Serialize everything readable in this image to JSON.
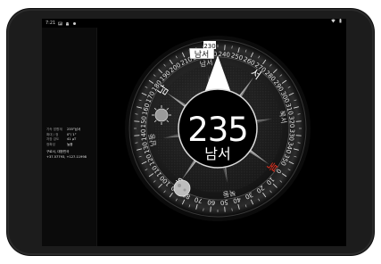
{
  "status_bar": {
    "time": "7:21",
    "left_icons": [
      "image-icon",
      "android-icon",
      "notification-icon"
    ],
    "right_icons": [
      "wifi-icon",
      "battery-icon"
    ]
  },
  "side_panel": {
    "rows": [
      {
        "key": "기속 방향계",
        "value": "235°남서"
      },
      {
        "key": "확대 / 정",
        "value": "0°/ 1°"
      },
      {
        "key": "자장 강도",
        "value": "41 μT"
      },
      {
        "key": "정확성",
        "value": "높음"
      }
    ],
    "location": "구로서, 대한민국",
    "coordinates": "+37.57793, +127.11998"
  },
  "compass": {
    "heading_value": "235",
    "heading_direction": "남서",
    "top_marker_label": "남서",
    "top_marker_degree": "230",
    "degree_scale": [
      "10",
      "20",
      "30",
      "40",
      "50",
      "60",
      "70",
      "80",
      "90",
      "100",
      "110",
      "120",
      "130",
      "140",
      "150",
      "160",
      "170",
      "180",
      "190",
      "200",
      "210",
      "220",
      "230",
      "240",
      "250",
      "260",
      "270",
      "280",
      "290",
      "300",
      "310",
      "320",
      "330",
      "340",
      "350",
      "0"
    ],
    "cardinals": {
      "north": "북",
      "east": "동",
      "south": "남",
      "west": "서"
    },
    "intercardinals": {
      "northeast": "북동",
      "southeast": "남동",
      "southwest": "남서",
      "northwest": "북서"
    },
    "colors": {
      "north": "#e0301f",
      "needle": "#ffffff",
      "accent": "#ffffff"
    }
  }
}
